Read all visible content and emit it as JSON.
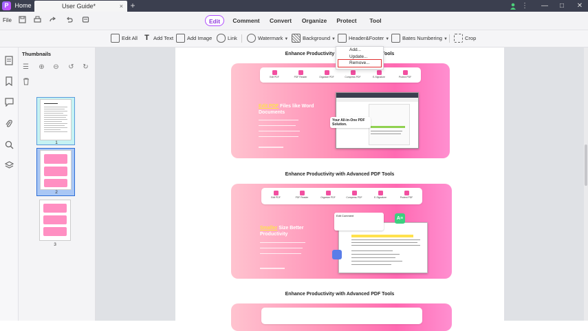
{
  "titlebar": {
    "logo": "P",
    "home_tab": "Home",
    "doc_tab": "User Guide*",
    "close_tab": "×",
    "add_tab": "+"
  },
  "window_controls": {
    "user": "user-icon",
    "more": "⋮",
    "minimize": "—",
    "maximize": "□",
    "close": "✕"
  },
  "menubar": {
    "file": "File",
    "items": [
      "Edit",
      "Comment",
      "Convert",
      "Organize",
      "Protect",
      "Tool"
    ]
  },
  "toolbar": {
    "edit_all": "Edit All",
    "add_text": "Add Text",
    "add_image": "Add Image",
    "link": "Link",
    "watermark": "Watermark",
    "background": "Background",
    "header_footer": "Header&Footer",
    "bates": "Bates Numbering",
    "crop": "Crop"
  },
  "header_footer_menu": [
    "Add...",
    "Update...",
    "Remove..."
  ],
  "thumbnails": {
    "title": "Thumbnails",
    "pages": [
      "1",
      "2",
      "3"
    ]
  },
  "document": {
    "section_title_1": "Enhance Productivity with Advanced PDF Tools",
    "section_title_2": "Enhance Productivity with Advanced PDF Tools",
    "section_title_3": "Enhance Productivity with Advanced PDF Tools",
    "nav_1": [
      "Edit PDF",
      "PDF Reader",
      "Organize PDF",
      "Compress PDF",
      "E-Signature",
      "Protect PDF"
    ],
    "nav_2": [
      "Edit PDF",
      "PDF Reader",
      "Organize PDF",
      "Compress PDF",
      "E-Signature",
      "Protect PDF"
    ],
    "hero_1": {
      "highlight": "Edit PDF",
      "rest": " Files like Word Documents"
    },
    "hero_2": {
      "highlight": "Smaller",
      "rest": " Size Better Productivity"
    },
    "chip_1": "Your All-in-One PDF Solution.",
    "panel_2": "Edit Comment"
  },
  "colors": {
    "accent": "#b04dff",
    "title_bar": "#3b3f4f",
    "banner_pink": "#ff6ab2"
  }
}
